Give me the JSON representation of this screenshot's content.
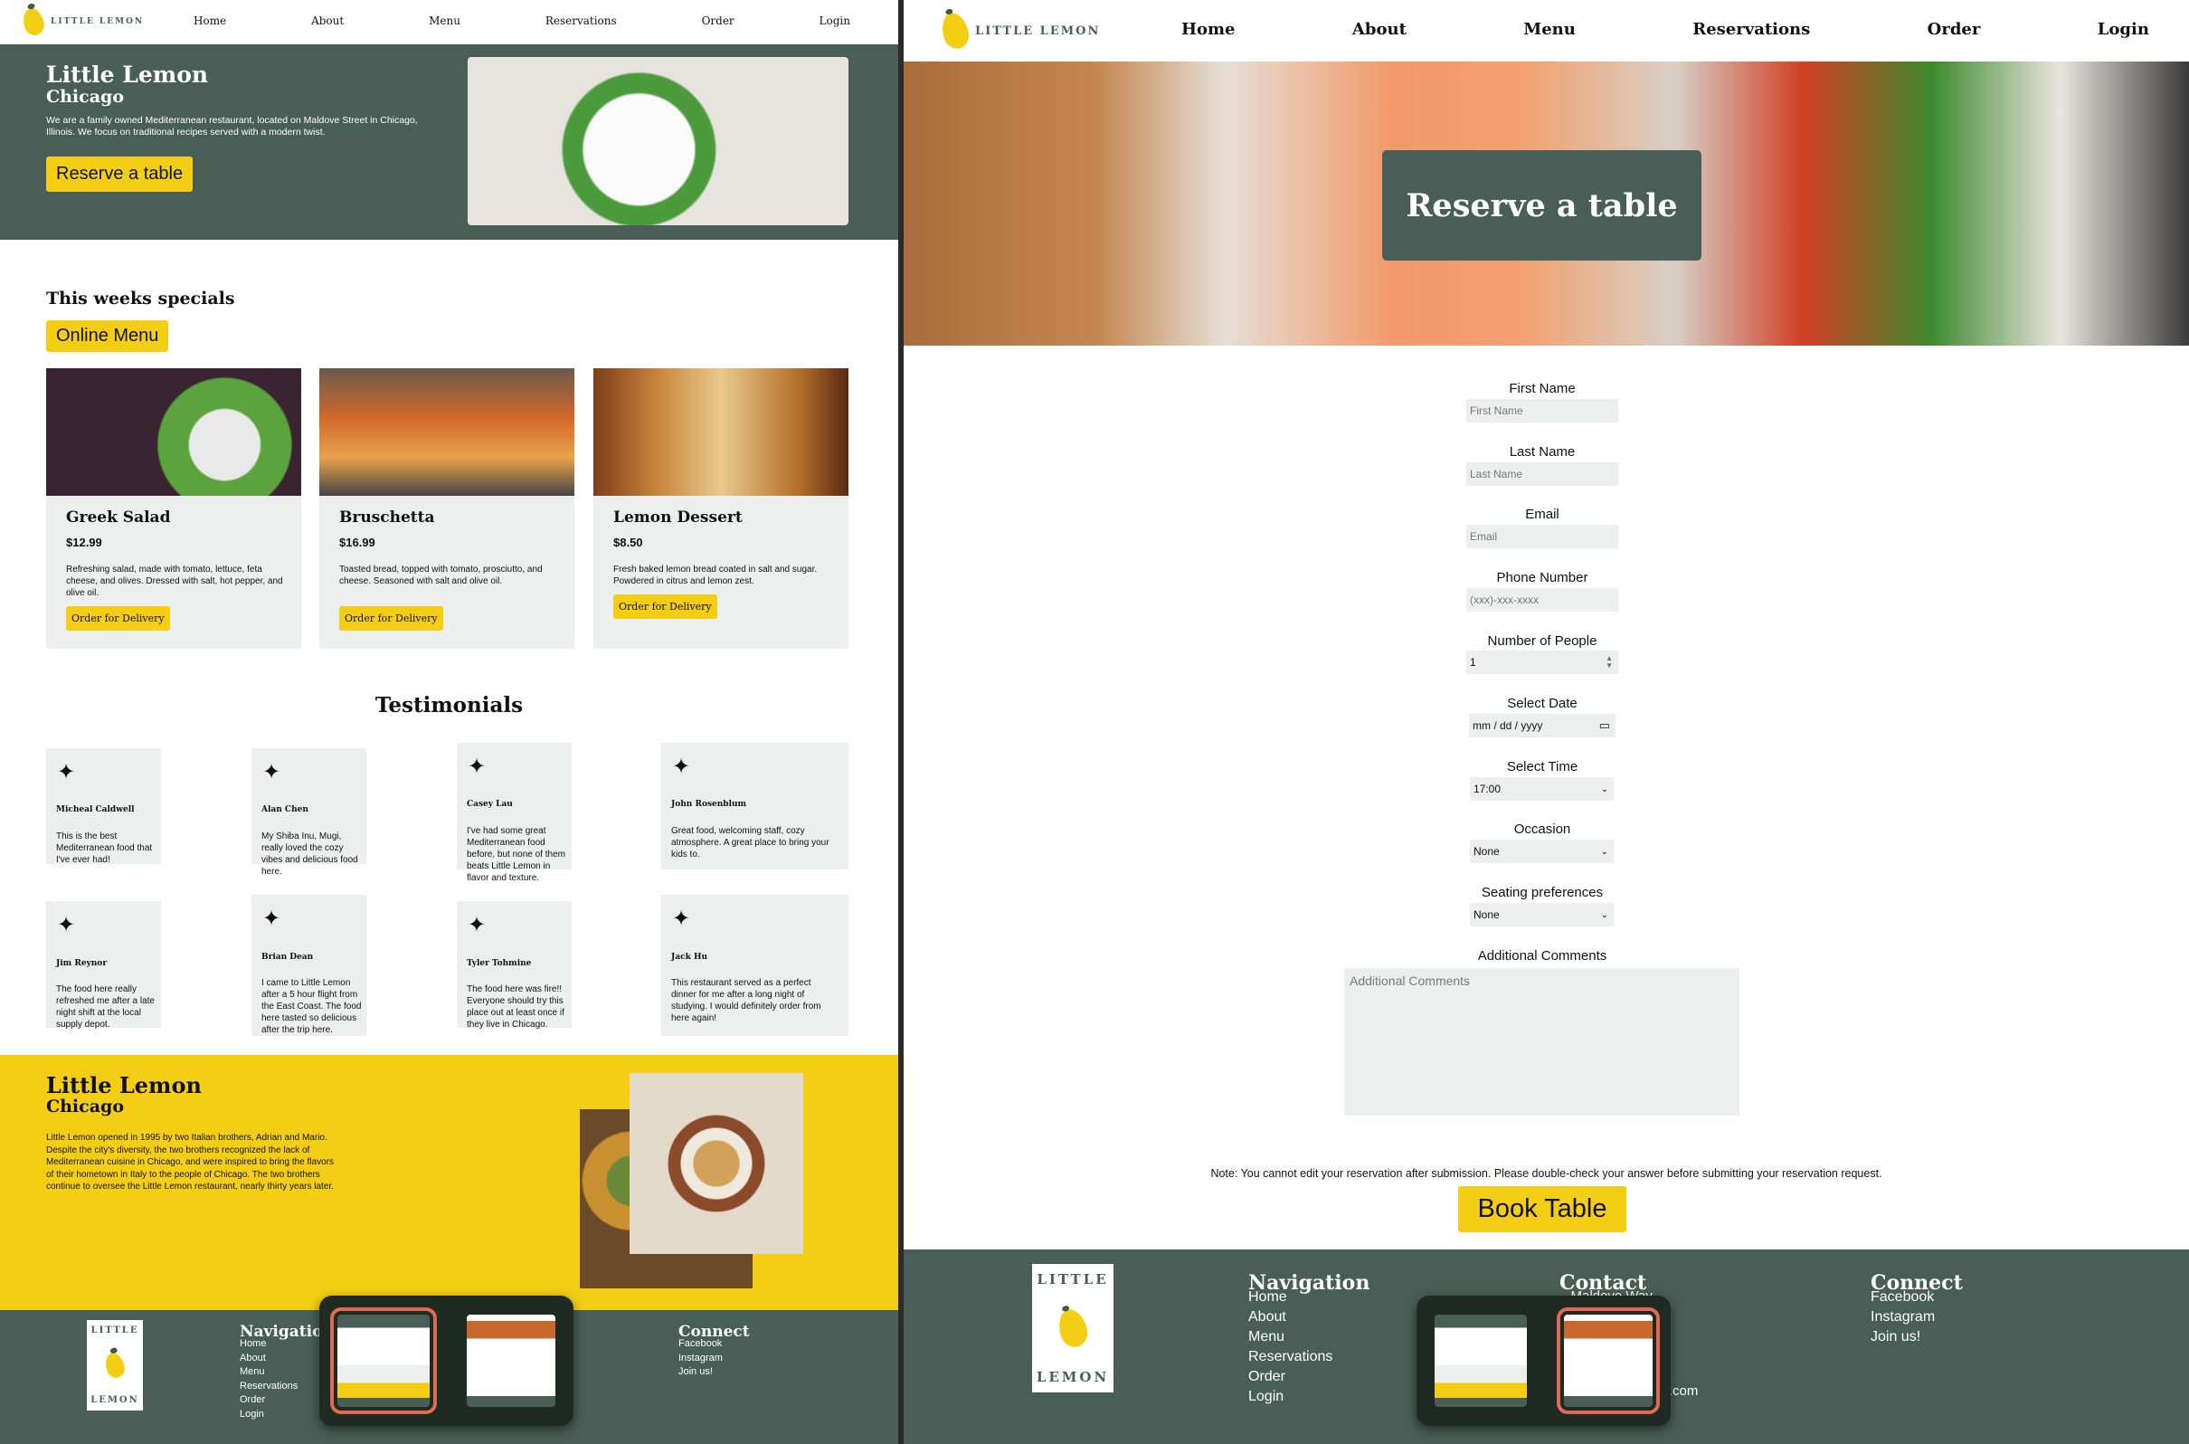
{
  "left": {
    "logo_text": "LITTLE LEMON",
    "nav": [
      "Home",
      "About",
      "Menu",
      "Reservations",
      "Order",
      "Login"
    ],
    "hero": {
      "title": "Little Lemon",
      "subtitle": "Chicago",
      "description": "We are a family owned Mediterranean restaurant, located on Maldove Street in Chicago, Illinois. We focus on traditional recipes served with a modern twist.",
      "button": "Reserve a table"
    },
    "specials": {
      "heading": "This weeks specials",
      "menu_button": "Online Menu",
      "items": [
        {
          "name": "Greek Salad",
          "price": "$12.99",
          "desc": "Refreshing salad, made with tomato, lettuce, feta cheese, and olives. Dressed with salt, hot pepper, and olive oil.",
          "button": "Order for Delivery"
        },
        {
          "name": "Bruschetta",
          "price": "$16.99",
          "desc": "Toasted bread, topped with tomato, prosciutto, and cheese. Seasoned with salt and olive oil.",
          "button": "Order for Delivery"
        },
        {
          "name": "Lemon Dessert",
          "price": "$8.50",
          "desc": "Fresh baked lemon bread coated in salt and sugar. Powdered in citrus and lemon zest.",
          "button": "Order for Delivery"
        }
      ]
    },
    "testimonials": {
      "heading": "Testimonials",
      "items": [
        {
          "name": "Micheal Caldwell",
          "text": "This is the best Mediterranean food that I've ever had!"
        },
        {
          "name": "Alan Chen",
          "text": "My Shiba Inu, Mugi, really loved the cozy vibes and delicious food here."
        },
        {
          "name": "Casey Lau",
          "text": "I've had some great Mediterranean food before, but none of them beats Little Lemon in flavor and texture."
        },
        {
          "name": "John Rosenblum",
          "text": "Great food, welcoming staff, cozy atmosphere. A great place to bring your kids to."
        },
        {
          "name": "Jim Reynor",
          "text": "The food here really refreshed me after a late night shift at the local supply depot."
        },
        {
          "name": "Brian Dean",
          "text": "I came to Little Lemon after a 5 hour flight from the East Coast. The food here tasted so delicious after the trip here."
        },
        {
          "name": "Tyler Tohmine",
          "text": "The food here was fire!! Everyone should try this place out at least once if they live in Chicago."
        },
        {
          "name": "Jack Hu",
          "text": "This restaurant served as a perfect dinner for me after a long night of studying. I would definitely order from here again!"
        }
      ]
    },
    "about": {
      "title": "Little Lemon",
      "subtitle": "Chicago",
      "text": "Little Lemon opened in 1995 by two Italian brothers, Adrian and Mario. Despite the city's diversity, the two brothers recognized the lack of Mediterranean cuisine in Chicago, and were inspired to bring the flavors of their hometown in Italy to the people of Chicago. The two brothers continue to oversee the Little Lemon restaurant, nearly thirty years later."
    },
    "footer": {
      "logo_top": "LITTLE",
      "logo_bottom": "LEMON",
      "nav_heading": "Navigation",
      "nav_items": [
        "Home",
        "About",
        "Menu",
        "Reservations",
        "Order",
        "Login"
      ],
      "connect_heading": "Connect",
      "connect_items": [
        "Facebook",
        "Instagram",
        "Join us!"
      ]
    }
  },
  "right": {
    "logo_text": "LITTLE LEMON",
    "nav": [
      "Home",
      "About",
      "Menu",
      "Reservations",
      "Order",
      "Login"
    ],
    "hero_title": "Reserve a table",
    "form": {
      "first_name": {
        "label": "First Name",
        "placeholder": "First Name"
      },
      "last_name": {
        "label": "Last Name",
        "placeholder": "Last Name"
      },
      "email": {
        "label": "Email",
        "placeholder": "Email"
      },
      "phone": {
        "label": "Phone Number",
        "placeholder": "(xxx)-xxx-xxxx"
      },
      "people": {
        "label": "Number of People",
        "value": "1"
      },
      "date": {
        "label": "Select Date",
        "value": "mm / dd / yyyy"
      },
      "time": {
        "label": "Select Time",
        "value": "17:00"
      },
      "occasion": {
        "label": "Occasion",
        "value": "None"
      },
      "seating": {
        "label": "Seating preferences",
        "value": "None"
      },
      "comments": {
        "label": "Additional Comments",
        "placeholder": "Additional Comments"
      },
      "note": "Note: You cannot edit your reservation after submission. Please double-check your answer before submitting your reservation request.",
      "submit": "Book Table"
    },
    "footer": {
      "logo_top": "LITTLE",
      "logo_bottom": "LEMON",
      "nav_heading": "Navigation",
      "nav_items": [
        "Home",
        "About",
        "Menu",
        "Reservations",
        "Order",
        "Login"
      ],
      "contact_heading": "Contact",
      "contact_partial_1": "...Maldove Way,",
      "contact_partial_2": "...n.com",
      "connect_heading": "Connect",
      "connect_items": [
        "Facebook",
        "Instagram",
        "Join us!"
      ]
    }
  },
  "colors": {
    "green": "#495e57",
    "yellow": "#f4ce14",
    "card": "#edefee",
    "switcher_highlight": "#e36a52"
  }
}
